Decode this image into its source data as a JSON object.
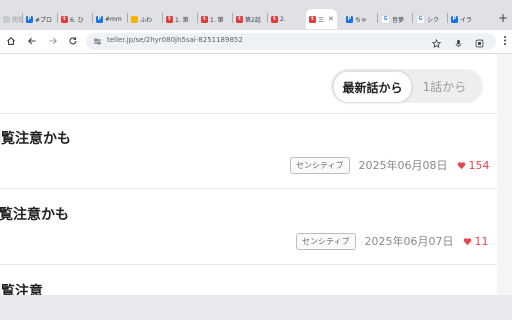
{
  "browser": {
    "tabs": [
      {
        "label": "閲覧",
        "favicon": "faded-tab-icon",
        "color": "#c8cbd0"
      },
      {
        "label": "#プロ",
        "favicon": "p-icon",
        "color": "#1a73e8"
      },
      {
        "label": "6. ひ",
        "favicon": "teller-icon",
        "color": "#e03c3c"
      },
      {
        "label": "#mm",
        "favicon": "p-icon",
        "color": "#1a73e8"
      },
      {
        "label": "ふわ",
        "favicon": "yellow-icon",
        "color": "#f4b400"
      },
      {
        "label": "1. 第",
        "favicon": "teller-icon",
        "color": "#e03c3c"
      },
      {
        "label": "1. 第",
        "favicon": "teller-icon",
        "color": "#e03c3c"
      },
      {
        "label": "第2話",
        "favicon": "teller-icon",
        "color": "#e03c3c"
      },
      {
        "label": "2. ",
        "favicon": "teller-icon",
        "color": "#e03c3c"
      },
      {
        "label": "三",
        "favicon": "teller-icon",
        "color": "#e03c3c",
        "active": true
      },
      {
        "label": "ちゃ",
        "favicon": "p-icon",
        "color": "#1a73e8"
      },
      {
        "label": "音夢",
        "favicon": "google-icon",
        "color": "#4285f4"
      },
      {
        "label": "シク",
        "favicon": "google-icon",
        "color": "#4285f4"
      },
      {
        "label": "イラ",
        "favicon": "p-icon",
        "color": "#1a73e8"
      }
    ],
    "url": "teller.jp/se/2hyr080jh5sai-8251189852",
    "colors": {
      "accent": "#e03c3c",
      "heart": "#e5484d"
    }
  },
  "page": {
    "sort": {
      "newest": "最新話から",
      "first": "1話から"
    },
    "episodes": [
      {
        "title": "閲覧注意かも",
        "tag": "センシティブ",
        "date": "2025年06月08日",
        "likes": "154"
      },
      {
        "title": "覧注意かも",
        "tag": "センシティブ",
        "date": "2025年06月07日",
        "likes": "11"
      },
      {
        "title": "閲覧注意",
        "tag": "",
        "date": "",
        "likes": ""
      }
    ]
  }
}
